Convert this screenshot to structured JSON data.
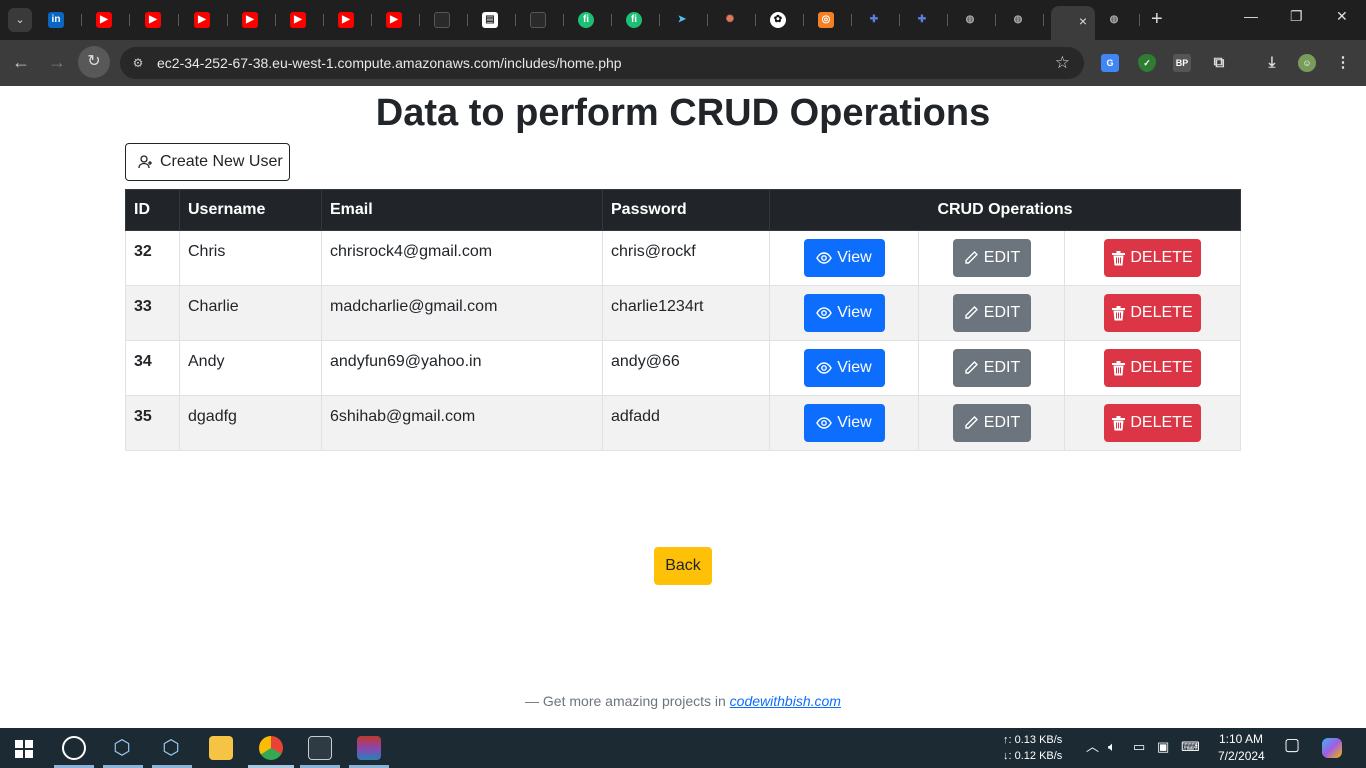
{
  "browser": {
    "url": "ec2-34-252-67-38.eu-west-1.compute.amazonaws.com/includes/home.php",
    "tab_close": "×",
    "new_tab": "+"
  },
  "page": {
    "title": "Data to perform CRUD Operations",
    "create_label": "Create New User",
    "columns": [
      "ID",
      "Username",
      "Email",
      "Password",
      "CRUD Operations"
    ],
    "rows": [
      {
        "id": "32",
        "username": "Chris",
        "email": "chrisrock4@gmail.com",
        "password": "chris@rockf"
      },
      {
        "id": "33",
        "username": "Charlie",
        "email": "madcharlie@gmail.com",
        "password": "charlie1234rt"
      },
      {
        "id": "34",
        "username": "Andy",
        "email": "andyfun69@yahoo.in",
        "password": "andy@66"
      },
      {
        "id": "35",
        "username": "dgadfg",
        "email": "6shihab@gmail.com",
        "password": "adfadd"
      }
    ],
    "view_label": "View",
    "edit_label": "EDIT",
    "delete_label": "DELETE",
    "back_label": "Back",
    "footer_text": "— Get more amazing projects in ",
    "footer_link": "codewithbish.com"
  },
  "taskbar": {
    "upload_speed": "↑: 0.13 KB/s",
    "download_speed": "↓: 0.12 KB/s",
    "time": "1:10 AM",
    "date": "7/2/2024"
  },
  "colors": {
    "primary": "#0d6efd",
    "secondary": "#6c757d",
    "danger": "#dc3545",
    "warning": "#ffc107",
    "dark": "#212529"
  }
}
